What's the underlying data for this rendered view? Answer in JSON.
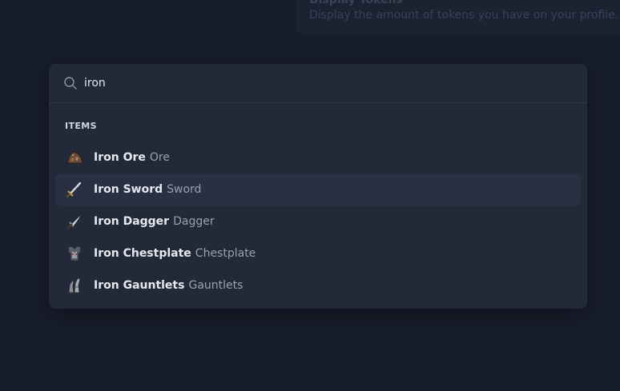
{
  "background": {
    "setting_title": "Display Tokens",
    "setting_description": "Display the amount of tokens you have on your profile."
  },
  "search": {
    "value": "iron",
    "icon": "search-icon"
  },
  "section": {
    "heading": "ITEMS"
  },
  "items": [
    {
      "name": "Iron Ore",
      "type": "Ore",
      "icon": "ore-icon"
    },
    {
      "name": "Iron Sword",
      "type": "Sword",
      "icon": "sword-icon",
      "highlighted": true
    },
    {
      "name": "Iron Dagger",
      "type": "Dagger",
      "icon": "dagger-icon"
    },
    {
      "name": "Iron Chestplate",
      "type": "Chestplate",
      "icon": "chestplate-icon"
    },
    {
      "name": "Iron Gauntlets",
      "type": "Gauntlets",
      "icon": "gauntlets-icon"
    }
  ],
  "colors": {
    "background": "#171d2a",
    "panel": "#222a39",
    "highlight_row": "#283041"
  }
}
